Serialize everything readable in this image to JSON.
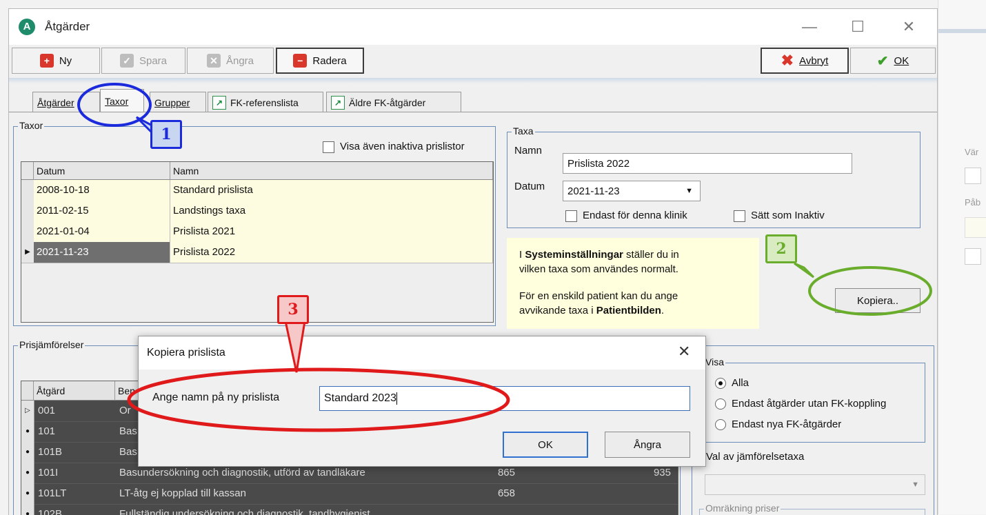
{
  "window": {
    "title": "Åtgärder",
    "icon_letter": "A"
  },
  "window_controls": {
    "minimize": "—",
    "maximize": "☐",
    "close": "✕"
  },
  "toolbar": {
    "new": "Ny",
    "save": "Spara",
    "undo": "Ångra",
    "delete": "Radera",
    "cancel": "Avbryt",
    "ok": "OK"
  },
  "tabs": [
    "Åtgärder",
    "Taxor",
    "Grupper",
    "FK-referenslista",
    "Äldre FK-åtgärder"
  ],
  "taxor": {
    "group_label": "Taxor",
    "show_inactive": "Visa även inaktiva prislistor",
    "columns": [
      "Datum",
      "Namn"
    ],
    "rows": [
      {
        "date": "2008-10-18",
        "name": "Standard prislista"
      },
      {
        "date": "2011-02-15",
        "name": "Landstings taxa"
      },
      {
        "date": "2021-01-04",
        "name": "Prislista 2021"
      },
      {
        "date": "2021-11-23",
        "name": "Prislista 2022"
      }
    ]
  },
  "taxa": {
    "group_label": "Taxa",
    "name_label": "Namn",
    "name_value": "Prislista 2022",
    "date_label": "Datum",
    "date_value": "2021-11-23",
    "only_clinic": "Endast för denna klinik",
    "set_inactive": "Sätt som Inaktiv"
  },
  "info": {
    "l1_pre": "I ",
    "l1_bold": "Systeminställningar",
    "l1_post": " ställer du in",
    "l2": "vilken taxa som användes normalt.",
    "l3": "För en enskild patient kan du ange",
    "l4_pre": "avvikande taxa i ",
    "l4_bold": "Patientbilden",
    "l4_post": "."
  },
  "copy_button": "Kopiera..",
  "prisjamforelser": {
    "group_label": "Prisjämförelser",
    "columns": [
      "Åtgärd",
      "Ben"
    ],
    "rows": [
      {
        "code": "001",
        "desc": "Or",
        "v1": "",
        "v2": ""
      },
      {
        "code": "101",
        "desc": "Bas",
        "v1": "",
        "v2": ""
      },
      {
        "code": "101B",
        "desc": "Bas",
        "v1": "",
        "v2": ""
      },
      {
        "code": "101I",
        "desc": "Basundersökning och diagnostik, utförd av tandläkare",
        "v1": "865",
        "v2": "935"
      },
      {
        "code": "101LT",
        "desc": "LT-åtg ej kopplad till kassan",
        "v1": "658",
        "v2": ""
      },
      {
        "code": "102B",
        "desc": "Fullständig undersökning och diagnostik, tandhygienist",
        "v1": "",
        "v2": ""
      }
    ]
  },
  "visa": {
    "group_label": "Visa",
    "options": [
      "Alla",
      "Endast åtgärder utan FK-koppling",
      "Endast nya FK-åtgärder"
    ],
    "selected": 0
  },
  "val_jamforelsetaxa": "Val av jämförelsetaxa",
  "omrakning": "Omräkning priser",
  "dialog": {
    "title": "Kopiera prislista",
    "prompt": "Ange namn på ny prislista",
    "value": "Standard 2023",
    "ok": "OK",
    "cancel": "Ångra"
  },
  "annotations": {
    "one": "1",
    "two": "2",
    "three": "3"
  },
  "background_app": {
    "label1": "Vär",
    "label2": "Påb"
  },
  "colors": {
    "blue": "#1b2bdc",
    "green": "#6aac2c",
    "red": "#e0191b"
  }
}
